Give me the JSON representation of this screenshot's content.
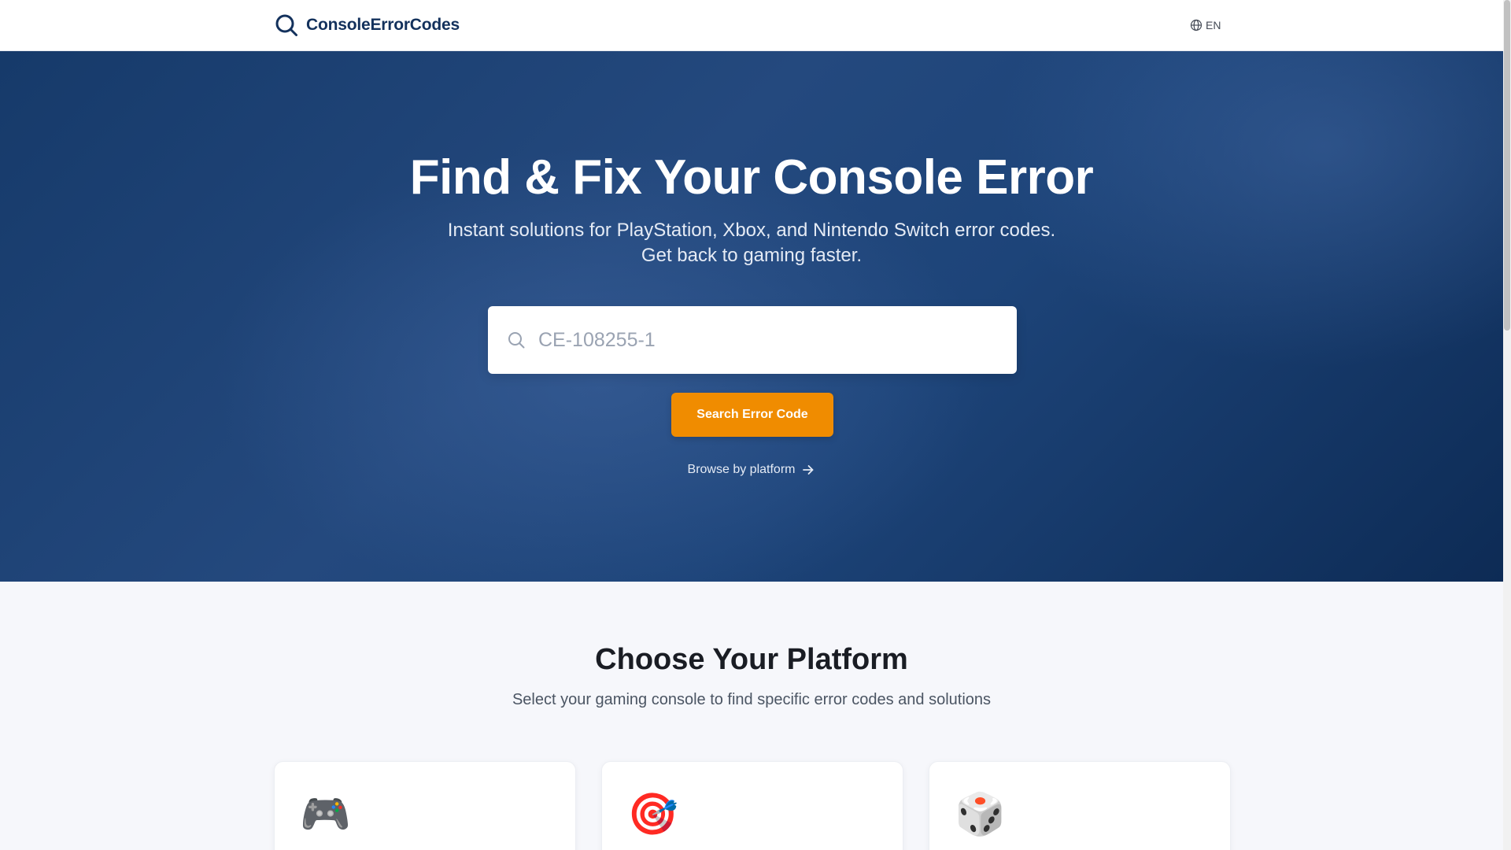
{
  "header": {
    "brand_name": "ConsoleErrorCodes",
    "brand_icon": "search-icon",
    "language_label": "EN",
    "language_icon": "globe-icon"
  },
  "hero": {
    "title": "Find & Fix Your Console Error",
    "subtitle_line1": "Instant solutions for PlayStation, Xbox, and Nintendo Switch error codes.",
    "subtitle_line2": "Get back to gaming faster.",
    "search": {
      "placeholder": "CE-108255-1",
      "value": "",
      "icon": "search-icon"
    },
    "search_button_label": "Search Error Code",
    "browse_link_label": "Browse by platform",
    "browse_link_icon": "arrow-right-icon"
  },
  "platforms": {
    "title": "Choose Your Platform",
    "subtitle": "Select your gaming console to find specific error codes and solutions",
    "cards": [
      {
        "icon": "🎮",
        "icon_name": "gamepad-icon"
      },
      {
        "icon": "🎯",
        "icon_name": "target-icon"
      },
      {
        "icon": "🎲",
        "icon_name": "dice-icon"
      }
    ]
  },
  "colors": {
    "brand": "#13315c",
    "hero_dark": "#0d2b55",
    "accent_orange": "#f08c00",
    "page_bg": "#f6f7fb"
  }
}
